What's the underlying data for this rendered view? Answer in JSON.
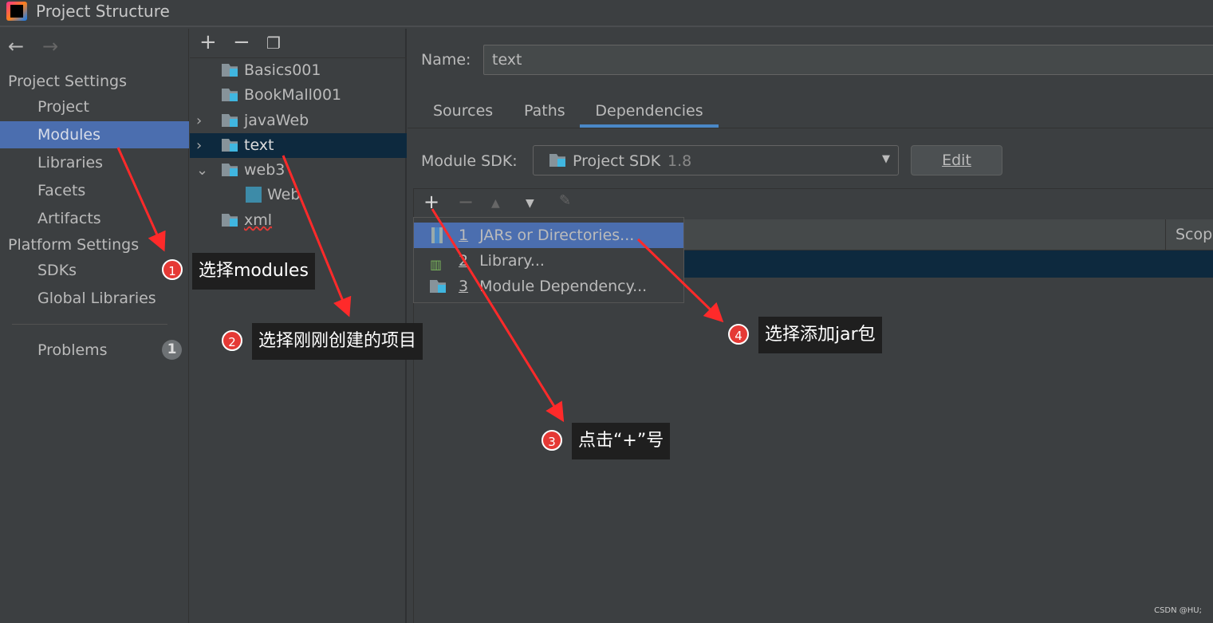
{
  "window": {
    "title": "Project Structure"
  },
  "sidebar": {
    "project_settings": "Project Settings",
    "items": [
      {
        "label": "Project"
      },
      {
        "label": "Modules",
        "selected": true
      },
      {
        "label": "Libraries"
      },
      {
        "label": "Facets"
      },
      {
        "label": "Artifacts"
      }
    ],
    "platform_settings": "Platform Settings",
    "platform_items": [
      {
        "label": "SDKs"
      },
      {
        "label": "Global Libraries"
      }
    ],
    "problems": "Problems",
    "problems_count": "1"
  },
  "modules": {
    "items": [
      {
        "label": "Basics001"
      },
      {
        "label": "BookMall001"
      },
      {
        "label": "javaWeb"
      },
      {
        "label": "text",
        "selected": true
      },
      {
        "label": "web3"
      },
      {
        "label": "Web"
      },
      {
        "label": "xml"
      }
    ]
  },
  "main": {
    "name_label": "Name:",
    "name_value": "text",
    "tabs": [
      {
        "label": "Sources"
      },
      {
        "label": "Paths"
      },
      {
        "label": "Dependencies",
        "active": true
      }
    ],
    "sdk_label": "Module SDK:",
    "sdk_value": "Project SDK",
    "sdk_version": "1.8",
    "edit_label": "Edit",
    "scope_header": "Scop"
  },
  "popup": {
    "items": [
      {
        "num": "1",
        "label": "JARs or Directories..."
      },
      {
        "num": "2",
        "label": "Library..."
      },
      {
        "num": "3",
        "label": "Module Dependency..."
      }
    ]
  },
  "annotations": [
    {
      "num": "1",
      "text": "选择modules"
    },
    {
      "num": "2",
      "text": "选择刚刚创建的项目"
    },
    {
      "num": "3",
      "text": "点击“+”号"
    },
    {
      "num": "4",
      "text": "选择添加jar包"
    }
  ],
  "watermark": "CSDN @HU;",
  "colors": {
    "selection": "#4b6eaf",
    "tree_selection": "#0d293e",
    "annotation_red": "#e53935",
    "folder_badge": "#40b6e0"
  }
}
